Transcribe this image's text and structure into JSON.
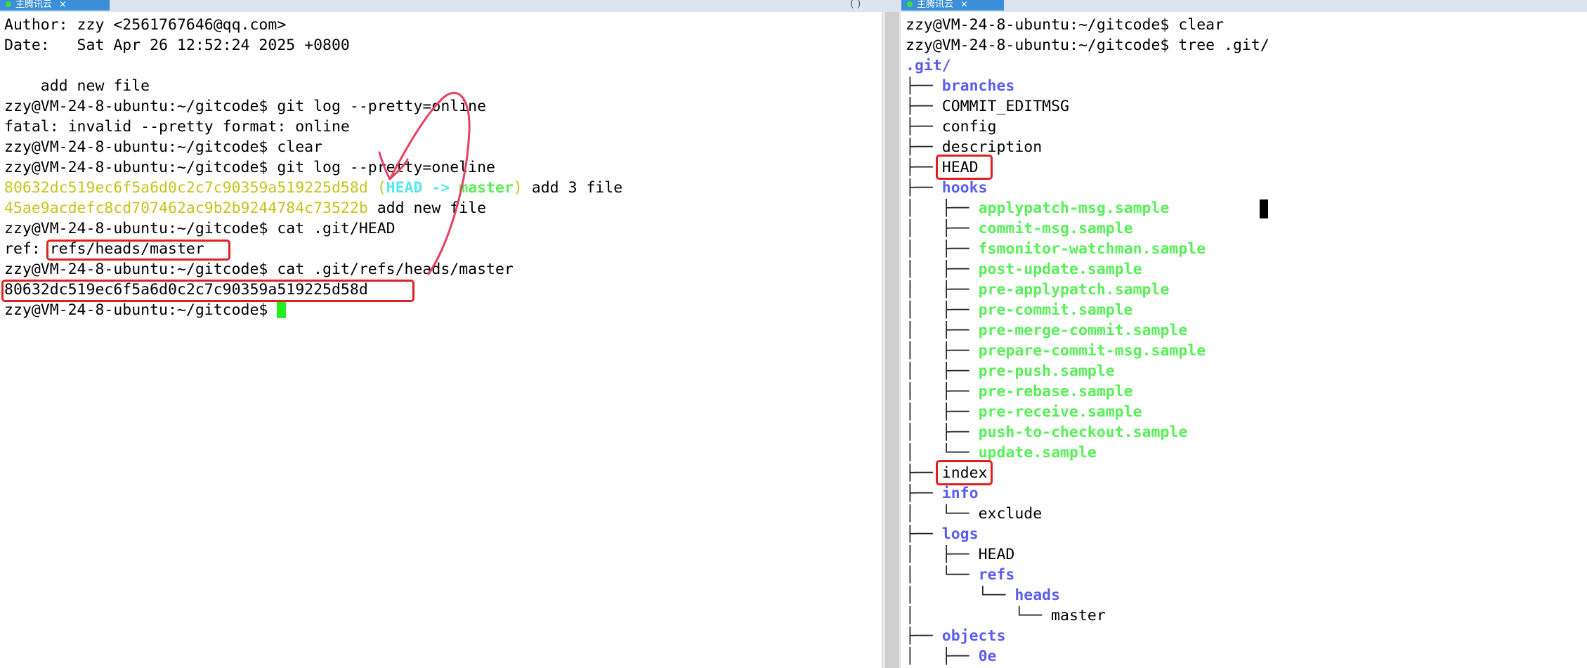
{
  "left_tab": {
    "title": "主腾讯云",
    "close": "×",
    "extra": "( )"
  },
  "right_tab": {
    "title": "主腾讯云",
    "close": "×"
  },
  "left_terminal": {
    "author_line": "Author: zzy <2561767646@qq.com>",
    "date_line": "Date:   Sat Apr 26 12:52:24 2025 +0800",
    "message_line": "    add new file",
    "prompt": "zzy@VM-24-8-ubuntu:~/gitcode$ ",
    "cmd1": "git log --pretty=online",
    "error_line": "fatal: invalid --pretty format: online",
    "cmd2": "clear",
    "cmd3": "git log --pretty=oneline",
    "commit1_hash": "80632dc519ec6f5a6d0c2c7c90359a519225d58d",
    "commit1_ref_open": " (",
    "commit1_head": "HEAD -> ",
    "commit1_branch": "master",
    "commit1_ref_close": ")",
    "commit1_msg": " add 3 file",
    "commit2_hash": "45ae9acdefc8cd707462ac9b2b9244784c73522b",
    "commit2_msg": " add new file",
    "cmd4": "cat .git/HEAD",
    "ref_label": "ref: ",
    "ref_value": "refs/heads/master",
    "cmd5": "cat .git/refs/heads/master",
    "master_hash": "80632dc519ec6f5a6d0c2c7c90359a519225d58d"
  },
  "right_terminal": {
    "prompt": "zzy@VM-24-8-ubuntu:~/gitcode$ ",
    "cmd1": "clear",
    "cmd2": "tree .git/",
    "root": ".git/",
    "tree": [
      {
        "prefix": "├── ",
        "name": "branches",
        "kind": "dir"
      },
      {
        "prefix": "├── ",
        "name": "COMMIT_EDITMSG",
        "kind": "file"
      },
      {
        "prefix": "├── ",
        "name": "config",
        "kind": "file"
      },
      {
        "prefix": "├── ",
        "name": "description",
        "kind": "file"
      },
      {
        "prefix": "├── ",
        "name": "HEAD",
        "kind": "file"
      },
      {
        "prefix": "├── ",
        "name": "hooks",
        "kind": "dir"
      },
      {
        "prefix": "│   ├── ",
        "name": "applypatch-msg.sample",
        "kind": "exec"
      },
      {
        "prefix": "│   ├── ",
        "name": "commit-msg.sample",
        "kind": "exec"
      },
      {
        "prefix": "│   ├── ",
        "name": "fsmonitor-watchman.sample",
        "kind": "exec"
      },
      {
        "prefix": "│   ├── ",
        "name": "post-update.sample",
        "kind": "exec"
      },
      {
        "prefix": "│   ├── ",
        "name": "pre-applypatch.sample",
        "kind": "exec"
      },
      {
        "prefix": "│   ├── ",
        "name": "pre-commit.sample",
        "kind": "exec"
      },
      {
        "prefix": "│   ├── ",
        "name": "pre-merge-commit.sample",
        "kind": "exec"
      },
      {
        "prefix": "│   ├── ",
        "name": "prepare-commit-msg.sample",
        "kind": "exec"
      },
      {
        "prefix": "│   ├── ",
        "name": "pre-push.sample",
        "kind": "exec"
      },
      {
        "prefix": "│   ├── ",
        "name": "pre-rebase.sample",
        "kind": "exec"
      },
      {
        "prefix": "│   ├── ",
        "name": "pre-receive.sample",
        "kind": "exec"
      },
      {
        "prefix": "│   ├── ",
        "name": "push-to-checkout.sample",
        "kind": "exec"
      },
      {
        "prefix": "│   └── ",
        "name": "update.sample",
        "kind": "exec"
      },
      {
        "prefix": "├── ",
        "name": "index",
        "kind": "file"
      },
      {
        "prefix": "├── ",
        "name": "info",
        "kind": "dir"
      },
      {
        "prefix": "│   └── ",
        "name": "exclude",
        "kind": "file"
      },
      {
        "prefix": "├── ",
        "name": "logs",
        "kind": "dir"
      },
      {
        "prefix": "│   ├── ",
        "name": "HEAD",
        "kind": "file"
      },
      {
        "prefix": "│   └── ",
        "name": "refs",
        "kind": "dir"
      },
      {
        "prefix": "│       └── ",
        "name": "heads",
        "kind": "dir"
      },
      {
        "prefix": "│           └── ",
        "name": "master",
        "kind": "file"
      },
      {
        "prefix": "├── ",
        "name": "objects",
        "kind": "dir"
      },
      {
        "prefix": "│   ├── ",
        "name": "0e",
        "kind": "dir"
      }
    ]
  },
  "colors": {
    "hash_yellow": "#c4c41e",
    "head_cyan": "#55e8f0",
    "branch_green": "#58f058",
    "dir_blue": "#5a5ef0",
    "exec_green": "#58f058",
    "cursor_green": "#22ee22",
    "highlight_red": "#e02020"
  }
}
